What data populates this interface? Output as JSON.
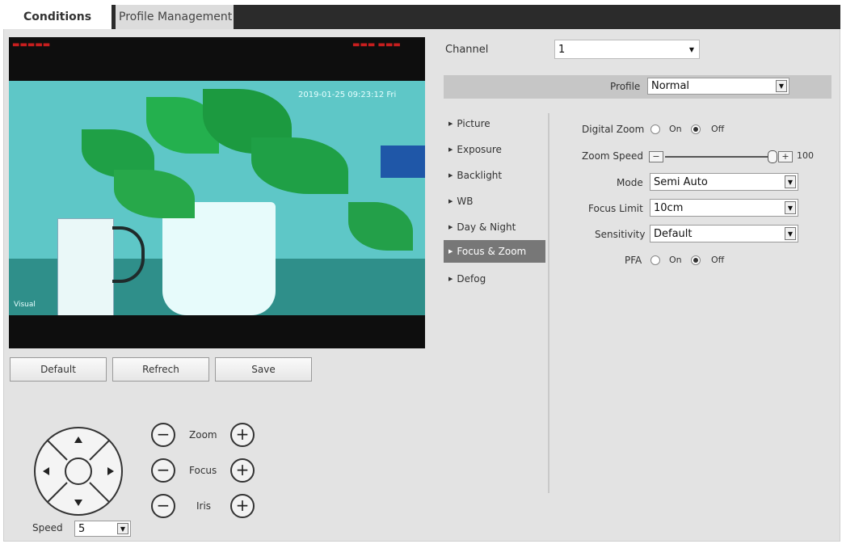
{
  "tabs": {
    "conditions": "Conditions",
    "profile_management": "Profile Management"
  },
  "video": {
    "timestamp": "2019-01-25 09:23:12 Fri",
    "channel_name": "Visual"
  },
  "actions": {
    "default": "Default",
    "refresh": "Refrech",
    "save": "Save"
  },
  "ptz": {
    "zoom": "Zoom",
    "focus": "Focus",
    "iris": "Iris",
    "minus": "−",
    "plus": "+",
    "speed_label": "Speed",
    "speed_value": "5"
  },
  "channel": {
    "label": "Channel",
    "value": "1"
  },
  "profile": {
    "label": "Profile",
    "value": "Normal"
  },
  "menu": [
    {
      "label": "Picture"
    },
    {
      "label": "Exposure"
    },
    {
      "label": "Backlight"
    },
    {
      "label": "WB"
    },
    {
      "label": "Day & Night"
    },
    {
      "label": "Focus & Zoom"
    },
    {
      "label": "Defog"
    }
  ],
  "menu_active_index": 5,
  "settings": {
    "digital_zoom_label": "Digital Zoom",
    "digital_zoom_value": "Off",
    "on_label": "On",
    "off_label": "Off",
    "zoom_speed_label": "Zoom Speed",
    "zoom_speed_value": "100",
    "zoom_speed_minus": "−",
    "zoom_speed_plus": "+",
    "mode_label": "Mode",
    "mode_value": "Semi Auto",
    "focus_limit_label": "Focus Limit",
    "focus_limit_value": "10cm",
    "sensitivity_label": "Sensitivity",
    "sensitivity_value": "Default",
    "pfa_label": "PFA",
    "pfa_value": "Off"
  },
  "colors": {
    "tab_bar": "#2b2b2b",
    "active_menu": "#777777",
    "profile_bar": "#c6c6c6",
    "panel_bg": "#e3e3e3",
    "video_bg": "#0e0e0e",
    "osd_red": "#c81e1e"
  }
}
